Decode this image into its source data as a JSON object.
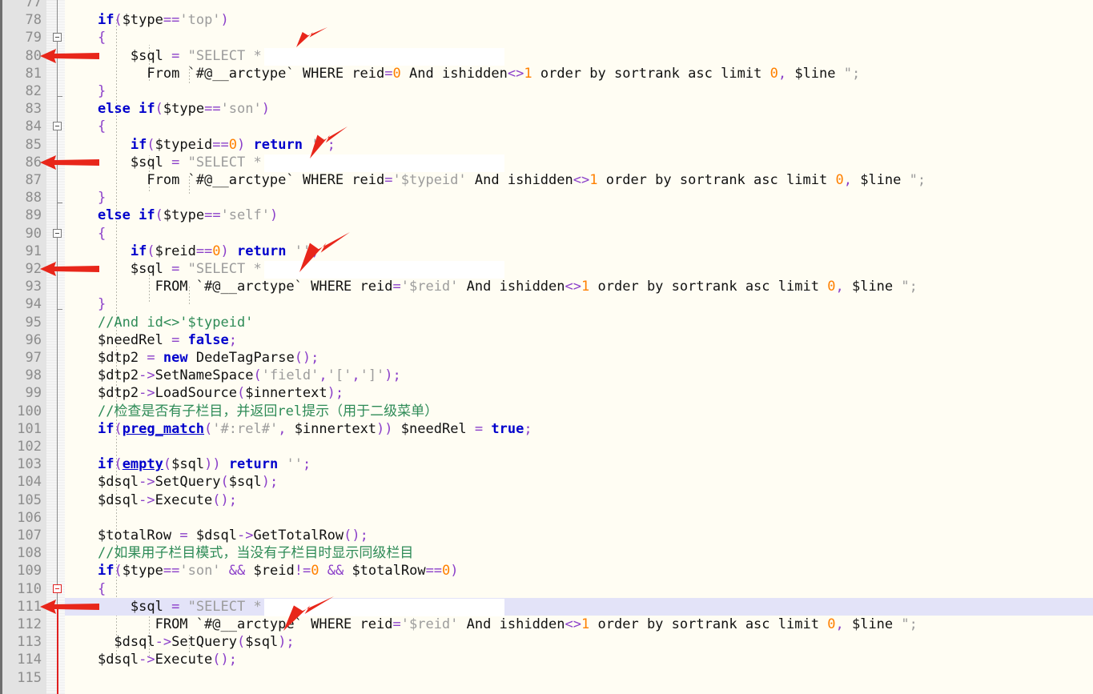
{
  "editor": {
    "name": "code-editor",
    "language": "PHP",
    "background_color": "#fffdf3",
    "gutter_color": "#e3e3e3",
    "line_number_color": "#8d8d8d",
    "current_line": 111,
    "current_line_highlight_color": "#e3e3f8",
    "first_visible_line": 77,
    "last_visible_line": 115,
    "annotation_color": "#e8261a"
  },
  "lines": [
    {
      "num": "77",
      "code": "",
      "partial": true
    },
    {
      "num": "78",
      "code": "    if($type=='top')"
    },
    {
      "num": "79",
      "code": "    {"
    },
    {
      "num": "80",
      "code": "        $sql = \"SELECT *"
    },
    {
      "num": "81",
      "code": "          From `#@__arctype` WHERE reid=0 And ishidden<>1 order by sortrank asc limit 0, $line \";"
    },
    {
      "num": "82",
      "code": "    }"
    },
    {
      "num": "83",
      "code": "    else if($type=='son')"
    },
    {
      "num": "84",
      "code": "    {"
    },
    {
      "num": "85",
      "code": "        if($typeid==0) return '';"
    },
    {
      "num": "86",
      "code": "        $sql = \"SELECT *"
    },
    {
      "num": "87",
      "code": "          From `#@__arctype` WHERE reid='$typeid' And ishidden<>1 order by sortrank asc limit 0, $line \";"
    },
    {
      "num": "88",
      "code": "    }"
    },
    {
      "num": "89",
      "code": "    else if($type=='self')"
    },
    {
      "num": "90",
      "code": "    {"
    },
    {
      "num": "91",
      "code": "        if($reid==0) return '';"
    },
    {
      "num": "92",
      "code": "        $sql = \"SELECT *"
    },
    {
      "num": "93",
      "code": "           FROM `#@__arctype` WHERE reid='$reid' And ishidden<>1 order by sortrank asc limit 0, $line \";"
    },
    {
      "num": "94",
      "code": "    }"
    },
    {
      "num": "95",
      "code": "    //And id<>'$typeid'"
    },
    {
      "num": "96",
      "code": "    $needRel = false;"
    },
    {
      "num": "97",
      "code": "    $dtp2 = new DedeTagParse();"
    },
    {
      "num": "98",
      "code": "    $dtp2->SetNameSpace('field','[',']');"
    },
    {
      "num": "99",
      "code": "    $dtp2->LoadSource($innertext);"
    },
    {
      "num": "100",
      "code": "    //检查是否有子栏目，并返回rel提示（用于二级菜单）"
    },
    {
      "num": "101",
      "code": "    if(preg_match('#:rel#', $innertext)) $needRel = true;"
    },
    {
      "num": "102",
      "code": ""
    },
    {
      "num": "103",
      "code": "    if(empty($sql)) return '';"
    },
    {
      "num": "104",
      "code": "    $dsql->SetQuery($sql);"
    },
    {
      "num": "105",
      "code": "    $dsql->Execute();"
    },
    {
      "num": "106",
      "code": ""
    },
    {
      "num": "107",
      "code": "    $totalRow = $dsql->GetTotalRow();"
    },
    {
      "num": "108",
      "code": "    //如果用子栏目模式，当没有子栏目时显示同级栏目"
    },
    {
      "num": "109",
      "code": "    if($type=='son' && $reid!=0 && $totalRow==0)"
    },
    {
      "num": "110",
      "code": "    {"
    },
    {
      "num": "111",
      "code": "        $sql = \"SELECT *"
    },
    {
      "num": "112",
      "code": "           FROM `#@__arctype` WHERE reid='$reid' And ishidden<>1 order by sortrank asc limit 0, $line \";"
    },
    {
      "num": "113",
      "code": "      $dsql->SetQuery($sql);"
    },
    {
      "num": "114",
      "code": "    $dsql->Execute();"
    },
    {
      "num": "115",
      "code": "",
      "partial": true
    }
  ],
  "fold_markers": [
    {
      "line": "79",
      "type": "collapse-box"
    },
    {
      "line": "82",
      "type": "fold-end"
    },
    {
      "line": "84",
      "type": "collapse-box"
    },
    {
      "line": "88",
      "type": "fold-end"
    },
    {
      "line": "90",
      "type": "collapse-box"
    },
    {
      "line": "94",
      "type": "fold-end"
    },
    {
      "line": "110",
      "type": "collapse-box-active"
    }
  ],
  "annotations": [
    {
      "id": "arrow-left-80",
      "kind": "left-arrow",
      "target_line": "80"
    },
    {
      "id": "arrow-diag-80",
      "kind": "diagonal-arrow",
      "target_line": "80"
    },
    {
      "id": "arrow-left-86",
      "kind": "left-arrow",
      "target_line": "86"
    },
    {
      "id": "arrow-diag-85",
      "kind": "diagonal-arrow",
      "target_line": "85"
    },
    {
      "id": "arrow-left-92",
      "kind": "left-arrow",
      "target_line": "92"
    },
    {
      "id": "arrow-diag-91",
      "kind": "diagonal-arrow",
      "target_line": "91"
    },
    {
      "id": "arrow-left-111",
      "kind": "left-arrow",
      "target_line": "111"
    },
    {
      "id": "arrow-diag-110",
      "kind": "diagonal-arrow",
      "target_line": "110"
    }
  ]
}
